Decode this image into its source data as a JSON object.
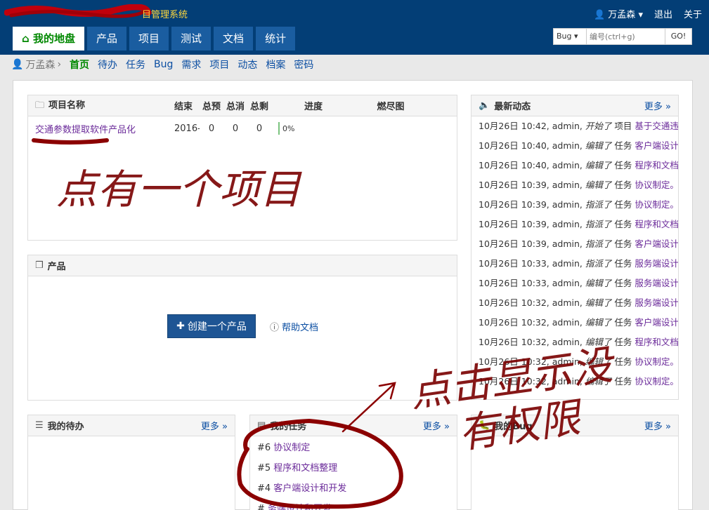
{
  "header": {
    "title": "目管理系统",
    "user_name": "万孟森",
    "logout": "退出",
    "about": "关于",
    "nav_tabs": [
      {
        "label": "我的地盘",
        "active": true
      },
      {
        "label": "产品"
      },
      {
        "label": "项目"
      },
      {
        "label": "测试"
      },
      {
        "label": "文档"
      },
      {
        "label": "统计"
      }
    ],
    "search": {
      "type": "Bug",
      "placeholder": "编号(ctrl+g)",
      "go": "GO!"
    }
  },
  "subnav": {
    "user": "万孟森",
    "items": [
      "首页",
      "待办",
      "任务",
      "Bug",
      "需求",
      "项目",
      "动态",
      "档案",
      "密码"
    ]
  },
  "projects": {
    "columns": [
      "项目名称",
      "结束",
      "总预",
      "总消",
      "总剩",
      "进度",
      "燃尽图"
    ],
    "rows": [
      {
        "name": "交通参数提取软件产品化",
        "end": "2016-",
        "estimate": "0",
        "consumed": "0",
        "left": "0",
        "progress": "0%"
      }
    ]
  },
  "products": {
    "title": "产品",
    "create_button": "创建一个产品",
    "help_link": "帮助文档"
  },
  "dynamic": {
    "title": "最新动态",
    "more": "更多",
    "items": [
      {
        "time": "10月26日 10:42,",
        "who": "admin",
        "action": "开始了",
        "type": "项目",
        "object": "基于交通违章"
      },
      {
        "time": "10月26日 10:40,",
        "who": "admin",
        "action": "编辑了",
        "type": "任务",
        "object": "客户端设计和"
      },
      {
        "time": "10月26日 10:40,",
        "who": "admin",
        "action": "编辑了",
        "type": "任务",
        "object": "程序和文档整"
      },
      {
        "time": "10月26日 10:39,",
        "who": "admin",
        "action": "编辑了",
        "type": "任务",
        "object": "协议制定。"
      },
      {
        "time": "10月26日 10:39,",
        "who": "admin",
        "action": "指派了",
        "type": "任务",
        "object": "协议制定。"
      },
      {
        "time": "10月26日 10:39,",
        "who": "admin",
        "action": "指派了",
        "type": "任务",
        "object": "程序和文档整"
      },
      {
        "time": "10月26日 10:39,",
        "who": "admin",
        "action": "指派了",
        "type": "任务",
        "object": "客户端设计和"
      },
      {
        "time": "10月26日 10:33,",
        "who": "admin",
        "action": "指派了",
        "type": "任务",
        "object": "服务端设计和"
      },
      {
        "time": "10月26日 10:33,",
        "who": "admin",
        "action": "编辑了",
        "type": "任务",
        "object": "服务端设计和"
      },
      {
        "time": "10月26日 10:32,",
        "who": "admin",
        "action": "编辑了",
        "type": "任务",
        "object": "服务端设计和"
      },
      {
        "time": "10月26日 10:32,",
        "who": "admin",
        "action": "编辑了",
        "type": "任务",
        "object": "客户端设计和"
      },
      {
        "time": "10月26日 10:32,",
        "who": "admin",
        "action": "编辑了",
        "type": "任务",
        "object": "程序和文档整"
      },
      {
        "time": "10月26日 10:32,",
        "who": "admin",
        "action": "编辑了",
        "type": "任务",
        "object": "协议制定。"
      },
      {
        "time": "10月26日 10:32,",
        "who": "admin",
        "action": "编辑了",
        "type": "任务",
        "object": "协议制定。"
      }
    ]
  },
  "todos": {
    "title": "我的待办",
    "more": "更多"
  },
  "tasks": {
    "title": "我的任务",
    "more": "更多",
    "items": [
      {
        "id": "#6",
        "name": "协议制定"
      },
      {
        "id": "#5",
        "name": "程序和文档整理"
      },
      {
        "id": "#4",
        "name": "客户端设计和开发"
      },
      {
        "id": "#",
        "name": "务端设计和开发"
      }
    ]
  },
  "bugs": {
    "title": "我的Bug",
    "more": "更多"
  },
  "colors": {
    "header_bg": "#033e76",
    "tab_bg": "#1a5da0",
    "active_green": "#008800",
    "link_blue": "#0b4ea2",
    "annotation_red": "#8b0000"
  },
  "annotations": {
    "note1": "点有一个项目",
    "note2": "点击显示没有权限"
  }
}
